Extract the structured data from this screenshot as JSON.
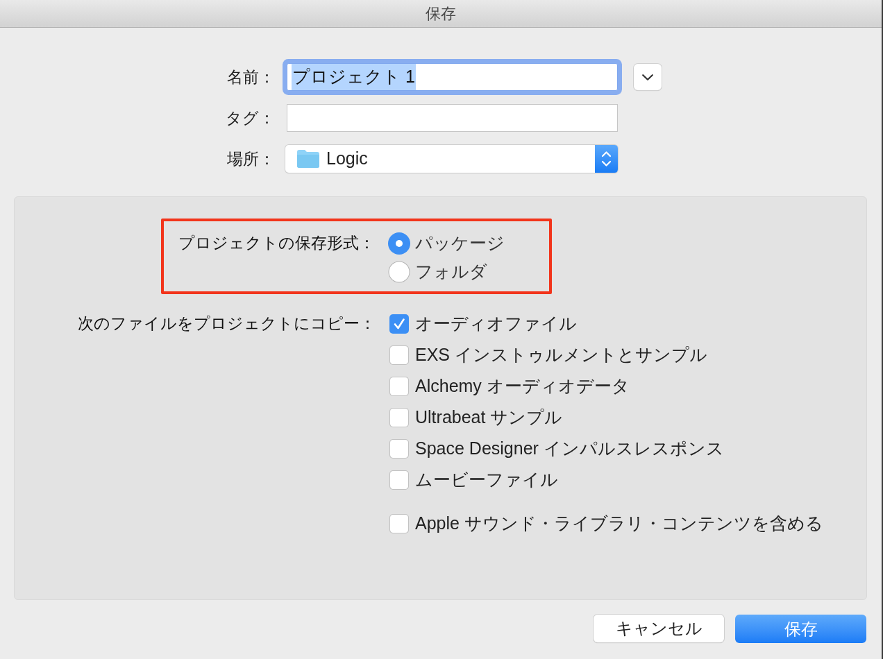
{
  "window": {
    "title": "保存"
  },
  "fields": [
    {
      "kind": "text",
      "label": "名前：",
      "value": "プロジェクト 1",
      "focused": true,
      "disclosure": true
    },
    {
      "kind": "text",
      "label": "タグ："
    },
    {
      "kind": "popup",
      "label": "場所：",
      "value": "Logic"
    }
  ],
  "format": {
    "label": "プロジェクトの保存形式：",
    "highlighted": true,
    "options": [
      {
        "label": "パッケージ",
        "selected": true
      },
      {
        "label": "フォルダ",
        "selected": false
      }
    ]
  },
  "copy": {
    "label": "次のファイルをプロジェクトにコピー：",
    "groups": [
      {
        "options": [
          {
            "label": "オーディオファイル",
            "checked": true
          },
          {
            "label": "EXS インストゥルメントとサンプル",
            "checked": false
          },
          {
            "label": "Alchemy オーディオデータ",
            "checked": false
          },
          {
            "label": "Ultrabeat サンプル",
            "checked": false
          },
          {
            "label": "Space Designer インパルスレスポンス",
            "checked": false
          },
          {
            "label": "ムービーファイル",
            "checked": false
          }
        ]
      },
      {
        "options": [
          {
            "label": "Apple サウンド・ライブラリ・コンテンツを含める",
            "checked": false
          }
        ]
      }
    ]
  },
  "buttons": [
    {
      "label": "キャンセル",
      "kind": "default"
    },
    {
      "label": "保存",
      "kind": "primary"
    }
  ]
}
